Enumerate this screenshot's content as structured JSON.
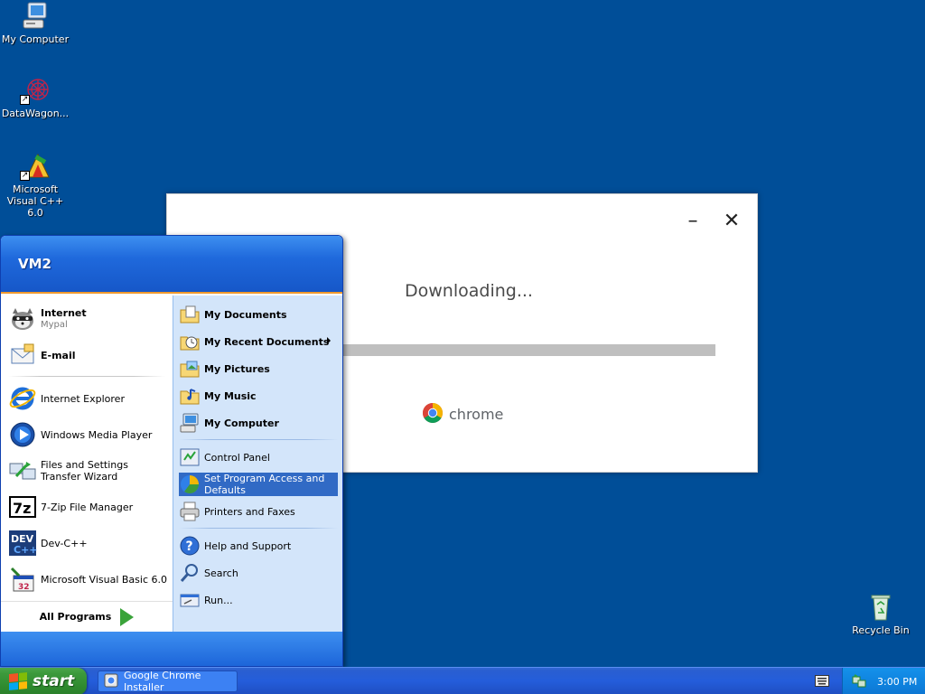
{
  "desktop": {
    "icons": [
      {
        "label": "My Computer"
      },
      {
        "label": "DataWagon..."
      },
      {
        "label": "Microsoft Visual C++ 6.0"
      },
      {
        "label": "Recycle Bin"
      }
    ]
  },
  "installer": {
    "minimize_glyph": "–",
    "close_glyph": "✕",
    "status": "Downloading...",
    "progress_percent": 100,
    "brand": "chrome"
  },
  "start_menu": {
    "user": "VM2",
    "pinned": [
      {
        "label": "Internet",
        "sub": "Mypal",
        "icon": "raccoon-browser-icon"
      },
      {
        "label": "E-mail",
        "icon": "email-icon"
      }
    ],
    "recent": [
      {
        "label": "Internet Explorer",
        "icon": "internet-explorer-icon"
      },
      {
        "label": "Windows Media Player",
        "icon": "media-player-icon"
      },
      {
        "label": "Files and Settings Transfer Wizard",
        "icon": "transfer-wizard-icon"
      },
      {
        "label": "7-Zip File Manager",
        "icon": "7zip-icon"
      },
      {
        "label": "Dev-C++",
        "icon": "devcpp-icon"
      },
      {
        "label": "Microsoft Visual Basic 6.0",
        "icon": "visual-basic-icon"
      }
    ],
    "all_programs": "All Programs",
    "places": [
      {
        "label": "My Documents",
        "icon": "folder-documents-icon"
      },
      {
        "label": "My Recent Documents",
        "icon": "recent-documents-icon"
      },
      {
        "label": "My Pictures",
        "icon": "folder-pictures-icon"
      },
      {
        "label": "My Music",
        "icon": "folder-music-icon"
      },
      {
        "label": "My Computer",
        "icon": "computer-icon"
      }
    ],
    "system": [
      {
        "label": "Control Panel",
        "icon": "control-panel-icon"
      },
      {
        "label": "Set Program Access and Defaults",
        "icon": "program-defaults-icon"
      },
      {
        "label": "Printers and Faxes",
        "icon": "printer-icon"
      }
    ],
    "help": [
      {
        "label": "Help and Support",
        "icon": "help-icon"
      },
      {
        "label": "Search",
        "icon": "search-icon"
      },
      {
        "label": "Run...",
        "icon": "run-icon"
      }
    ]
  },
  "taskbar": {
    "start_label": "start",
    "task_button": "Google Chrome Installer",
    "clock": "3:00 PM"
  },
  "colors": {
    "desktop_bg": "#004e98",
    "highlight": "#316ac5",
    "taskbar": "#245ddb",
    "start_green": "#3c9a3c"
  }
}
